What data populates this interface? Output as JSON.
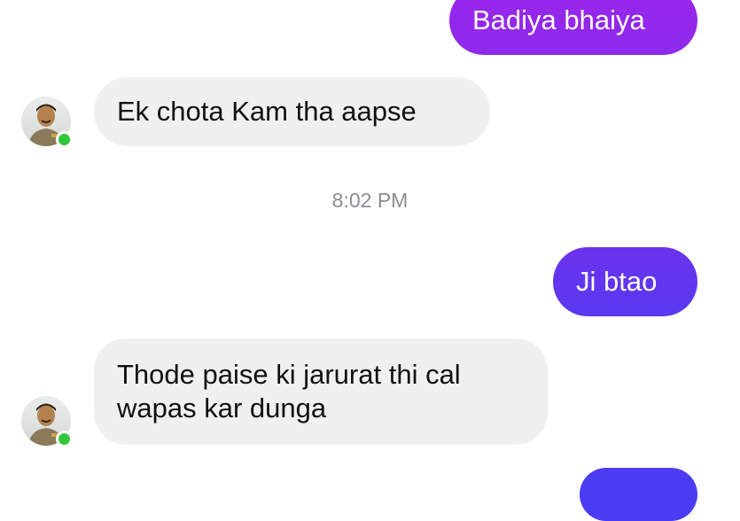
{
  "colors": {
    "outgoing_bubble_top": "#9b25e8",
    "outgoing_bubble_bottom": "#4a3cf2",
    "incoming_bubble": "#f0f0f0",
    "online_dot": "#31c738",
    "timestamp_text": "#8a8d91"
  },
  "messages": [
    {
      "direction": "outgoing",
      "text": "Badiya bhaiya"
    },
    {
      "direction": "incoming",
      "text": "Ek chota Kam tha aapse"
    },
    {
      "direction": "divider",
      "text": "8:02 PM"
    },
    {
      "direction": "outgoing",
      "text": "Ji btao"
    },
    {
      "direction": "incoming",
      "lines": [
        "Thode paise ki jarurat thi cal",
        "wapas kar dunga"
      ]
    },
    {
      "direction": "outgoing",
      "text": ""
    }
  ],
  "contact": {
    "avatar_icon": "profile-photo-icon",
    "online": true
  }
}
